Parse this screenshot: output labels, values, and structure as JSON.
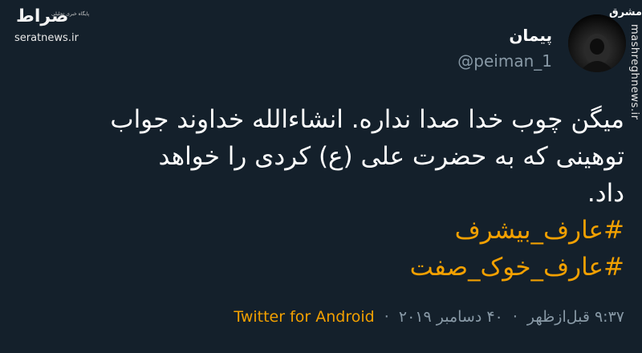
{
  "watermark_left": {
    "logo": "صراط",
    "tagline": "پایگاه خبری تحلیلی",
    "site": "seratnews.ir"
  },
  "watermark_right": {
    "logo": "مشرق",
    "site": "mashreghnews.ir"
  },
  "author": {
    "display_name": "پیمان",
    "handle": "@peiman_1"
  },
  "tweet": {
    "lines": [
      "میگن چوب خدا صدا نداره. انشاءالله خداوند جواب",
      "توهینی که  به حضرت علی (ع) کردی را خواهد",
      "داد."
    ],
    "hashtags": [
      "#عارف_بیشرف",
      "#عارف_خوک_صفت"
    ]
  },
  "meta": {
    "time": "۹:۳۷ قبل‌ازظهر",
    "date": "۴۰ دسامبر ۲۰۱۹",
    "separator": "·",
    "source": "Twitter for Android"
  },
  "colors": {
    "background": "#14202b",
    "text": "#ffffff",
    "muted": "#8899a6",
    "accent": "#f2a000"
  }
}
